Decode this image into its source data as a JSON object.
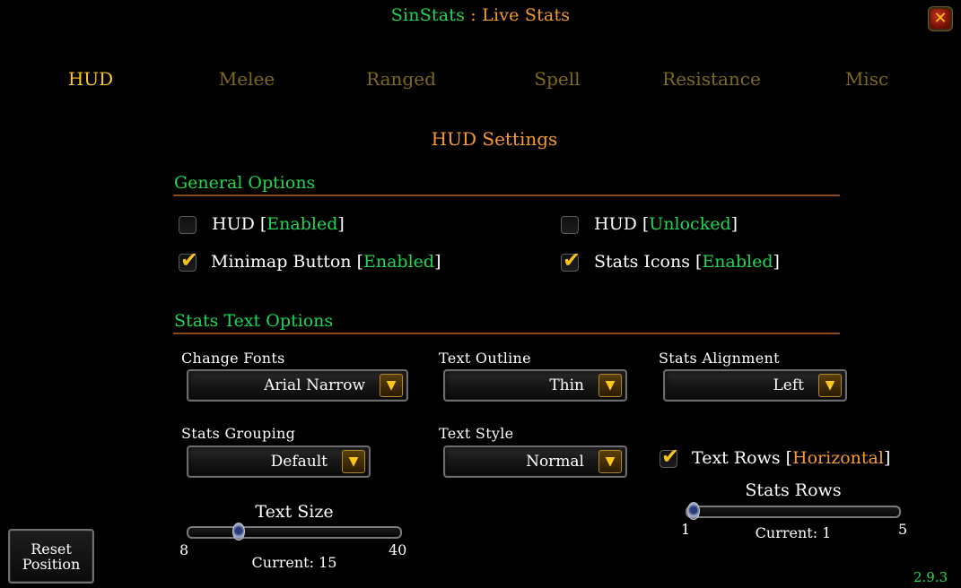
{
  "window": {
    "title_addon": "SinStats",
    "title_sep": " : ",
    "title_sub": "Live Stats",
    "close_label": "✕",
    "version": "2.9.3"
  },
  "tabs": [
    {
      "label": "HUD",
      "active": true
    },
    {
      "label": "Melee",
      "active": false
    },
    {
      "label": "Ranged",
      "active": false
    },
    {
      "label": "Spell",
      "active": false
    },
    {
      "label": "Resistance",
      "active": false
    },
    {
      "label": "Misc",
      "active": false
    }
  ],
  "page_heading": "HUD Settings",
  "general": {
    "heading": "General Options",
    "options": [
      {
        "label": "HUD",
        "state": "Enabled",
        "checked": false
      },
      {
        "label": "HUD",
        "state": "Unlocked",
        "checked": false
      },
      {
        "label": "Minimap Button",
        "state": "Enabled",
        "checked": true
      },
      {
        "label": "Stats Icons",
        "state": "Enabled",
        "checked": true
      }
    ]
  },
  "stats_text": {
    "heading": "Stats Text Options",
    "change_fonts": {
      "label": "Change Fonts",
      "value": "Arial Narrow"
    },
    "text_outline": {
      "label": "Text Outline",
      "value": "Thin"
    },
    "stats_alignment": {
      "label": "Stats Alignment",
      "value": "Left"
    },
    "stats_grouping": {
      "label": "Stats Grouping",
      "value": "Default"
    },
    "text_style": {
      "label": "Text Style",
      "value": "Normal"
    },
    "text_rows": {
      "label": "Text Rows",
      "state": "Horizontal",
      "checked": true
    },
    "text_size": {
      "label": "Text Size",
      "min": "8",
      "max": "40",
      "current_text": "Current: 15",
      "value": 15
    },
    "stats_rows": {
      "label": "Stats Rows",
      "min": "1",
      "max": "5",
      "current_text": "Current: 1",
      "value": 1
    }
  },
  "reset_button": {
    "line1": "Reset",
    "line2": "Position"
  },
  "colors": {
    "green": "#1fd655",
    "orange": "#f79a2b",
    "gold_active": "#ffc61d",
    "gold_inactive": "#7e6a18"
  },
  "icons": {
    "close": "close-icon",
    "dropdown": "chevron-down-icon",
    "check": "checkmark-icon"
  }
}
